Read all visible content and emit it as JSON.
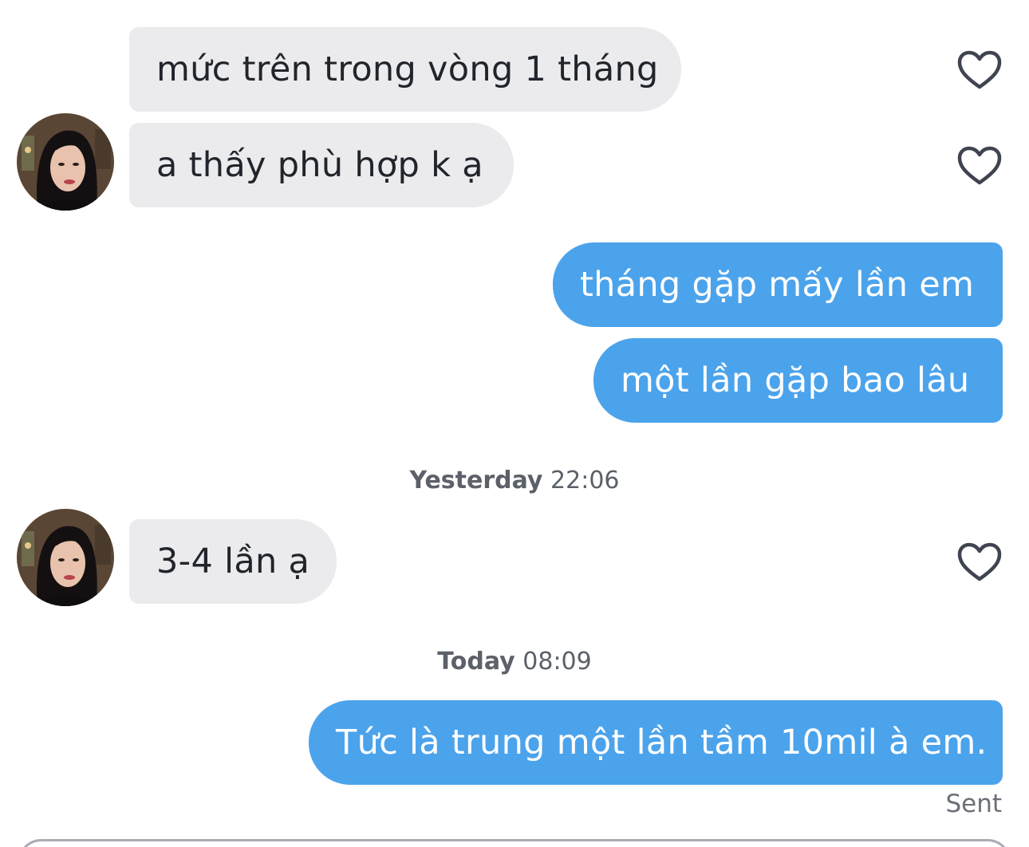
{
  "messages": [
    {
      "text": "mức trên trong vòng 1 tháng",
      "direction": "incoming",
      "liked": false
    },
    {
      "text": "a thấy phù hợp k ạ",
      "direction": "incoming",
      "liked": false
    },
    {
      "text": "tháng gặp mấy lần em",
      "direction": "outgoing"
    },
    {
      "text": "một lần gặp bao lâu",
      "direction": "outgoing"
    },
    {
      "text": "3-4 lần ạ",
      "direction": "incoming",
      "liked": false
    },
    {
      "text": "Tức là trung một lần tầm 10mil à em.",
      "direction": "outgoing"
    }
  ],
  "timestamps": [
    {
      "day": "Yesterday",
      "time": "22:06"
    },
    {
      "day": "Today",
      "time": "08:09"
    }
  ],
  "status": {
    "sent_label": "Sent"
  },
  "colors": {
    "incoming_bubble": "#ebebee",
    "outgoing_bubble": "#4ba3ec",
    "heart_stroke": "#3f4450"
  },
  "icons": {
    "like": "heart-outline-icon",
    "avatar": "contact-avatar"
  }
}
